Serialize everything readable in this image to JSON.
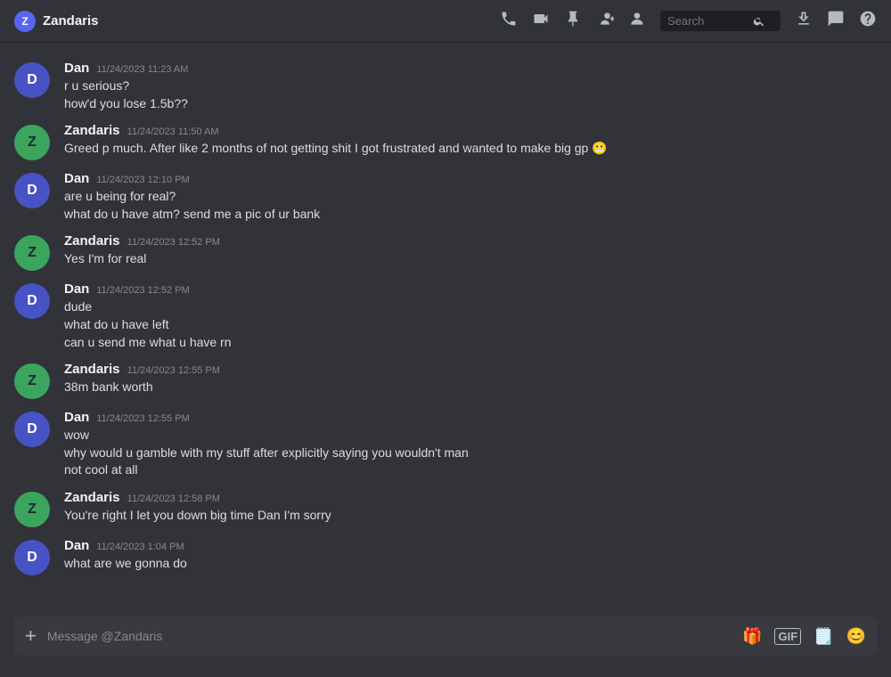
{
  "header": {
    "channel_name": "Zandaris",
    "avatar_initial": "Z",
    "search_placeholder": "Search"
  },
  "messages": [
    {
      "id": 1,
      "author": "Dan",
      "author_type": "dan",
      "timestamp": "11/24/2023 11:23 AM",
      "lines": [
        "r u serious?",
        "how'd you lose 1.5b??"
      ]
    },
    {
      "id": 2,
      "author": "Zandaris",
      "author_type": "zan",
      "timestamp": "11/24/2023 11:50 AM",
      "lines": [
        "Greed p much. After like 2 months of not getting shit I got frustrated and wanted to make big gp 😬"
      ]
    },
    {
      "id": 3,
      "author": "Dan",
      "author_type": "dan",
      "timestamp": "11/24/2023 12:10 PM",
      "lines": [
        "are u being for real?",
        "what do u have atm? send me a pic of ur bank"
      ]
    },
    {
      "id": 4,
      "author": "Zandaris",
      "author_type": "zan",
      "timestamp": "11/24/2023 12:52 PM",
      "lines": [
        "Yes I'm for real"
      ]
    },
    {
      "id": 5,
      "author": "Dan",
      "author_type": "dan",
      "timestamp": "11/24/2023 12:52 PM",
      "lines": [
        "dude",
        "what do u have left",
        "can u send me what u have rn"
      ]
    },
    {
      "id": 6,
      "author": "Zandaris",
      "author_type": "zan",
      "timestamp": "11/24/2023 12:55 PM",
      "lines": [
        "38m bank worth"
      ]
    },
    {
      "id": 7,
      "author": "Dan",
      "author_type": "dan",
      "timestamp": "11/24/2023 12:55 PM",
      "lines": [
        "wow",
        "why would u gamble with my stuff after explicitly saying you wouldn't man",
        "not cool at all"
      ]
    },
    {
      "id": 8,
      "author": "Zandaris",
      "author_type": "zan",
      "timestamp": "11/24/2023 12:58 PM",
      "lines": [
        "You're right I let you down big time Dan I'm sorry"
      ]
    },
    {
      "id": 9,
      "author": "Dan",
      "author_type": "dan",
      "timestamp": "11/24/2023 1:04 PM",
      "lines": [
        "what are we gonna do"
      ]
    }
  ],
  "input": {
    "placeholder": "Message @Zandaris"
  }
}
